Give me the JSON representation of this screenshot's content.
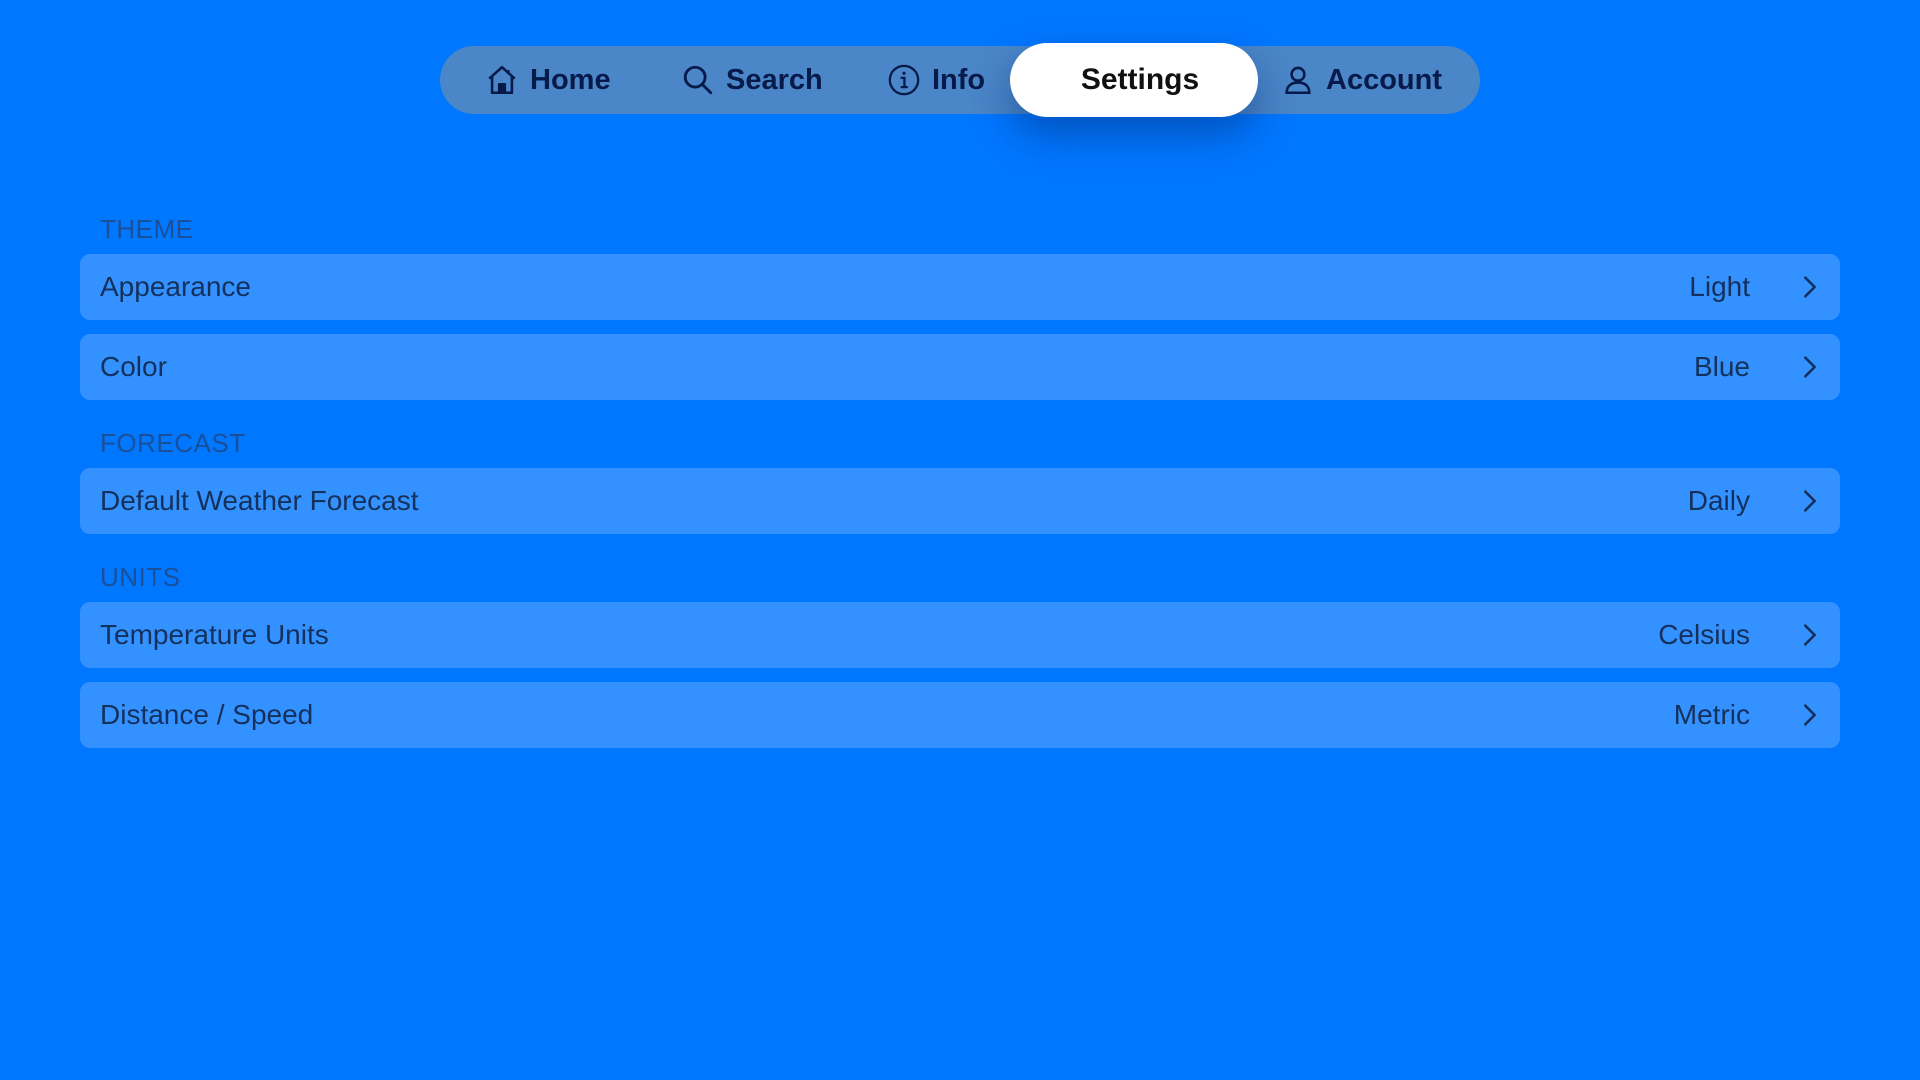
{
  "tabs": {
    "home": {
      "label": "Home",
      "icon": "home-icon"
    },
    "search": {
      "label": "Search",
      "icon": "search-icon"
    },
    "info": {
      "label": "Info",
      "icon": "info-icon"
    },
    "settings": {
      "label": "Settings",
      "icon": "gear-icon",
      "selected": true
    },
    "account": {
      "label": "Account",
      "icon": "person-icon"
    }
  },
  "sections": {
    "theme": {
      "header": "THEME",
      "rows": [
        {
          "label": "Appearance",
          "value": "Light"
        },
        {
          "label": "Color",
          "value": "Blue"
        }
      ]
    },
    "forecast": {
      "header": "FORECAST",
      "rows": [
        {
          "label": "Default Weather Forecast",
          "value": "Daily"
        }
      ]
    },
    "units": {
      "header": "UNITS",
      "rows": [
        {
          "label": "Temperature Units",
          "value": "Celsius"
        },
        {
          "label": "Distance / Speed",
          "value": "Metric"
        }
      ]
    }
  },
  "colors": {
    "background": "#0077FF",
    "tabbar": "#4A86C8",
    "row": "#3392FF",
    "selected_tab": "#FFFFFF"
  }
}
